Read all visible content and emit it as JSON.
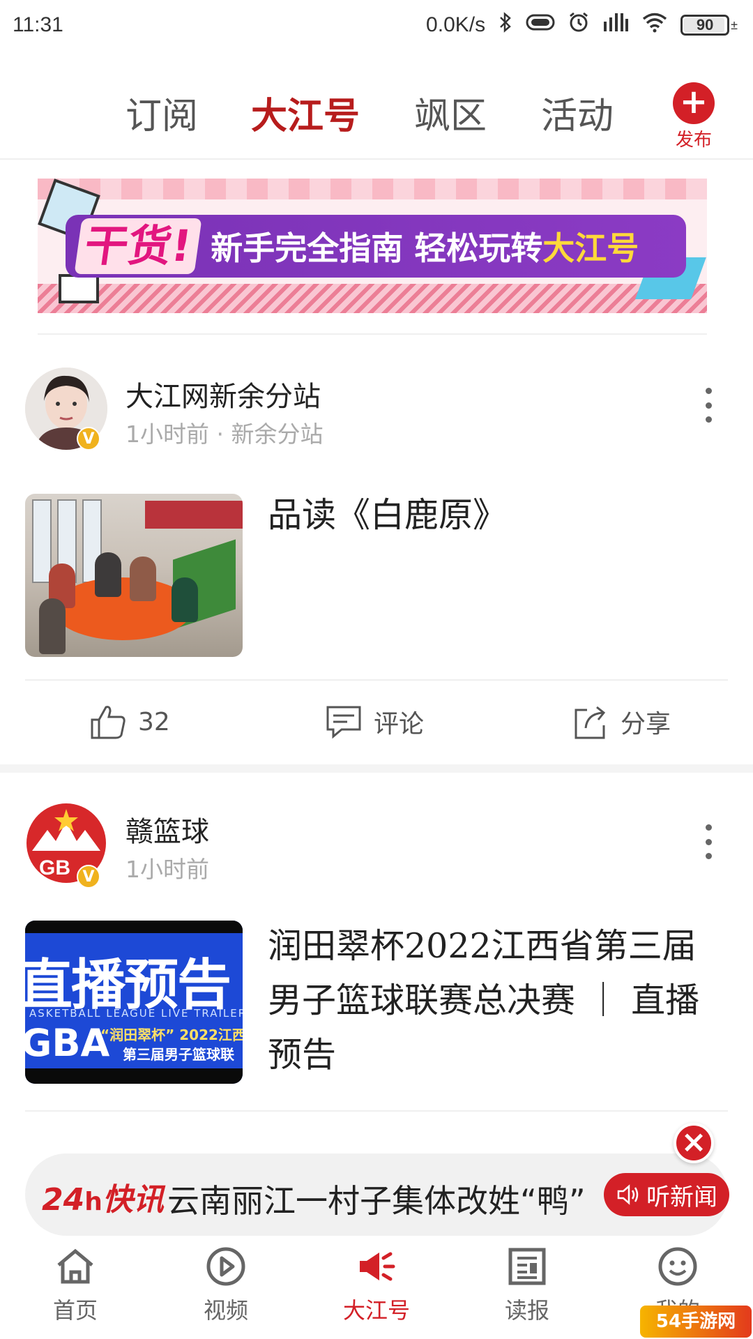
{
  "status_bar": {
    "time": "11:31",
    "net_speed": "0.0K/s",
    "battery": "90"
  },
  "top_tabs": [
    {
      "label": "订阅"
    },
    {
      "label": "大江号"
    },
    {
      "label": "飒区"
    },
    {
      "label": "活动"
    }
  ],
  "publish_label": "发布",
  "banner": {
    "lead": "干货!",
    "text": "新手完全指南 轻松玩转",
    "highlight": "大江号"
  },
  "posts": [
    {
      "author": "大江网新余分站",
      "meta": "1小时前 · 新余分站",
      "title": "品读《白鹿原》",
      "likes": "32",
      "comment_label": "评论",
      "share_label": "分享"
    },
    {
      "author": "赣篮球",
      "meta": "1小时前",
      "title": "润田翠杯2022江西省第三届男子篮球联赛总决赛 ｜ 直播预告",
      "thumb_big": "直播预告",
      "thumb_small": "ASKETBALL LEAGUE LIVE TRAILER",
      "thumb_gba": "GBA",
      "thumb_sub": "“润田翠杯” 2022江西",
      "thumb_sub2": "第三届男子篮球联",
      "avatar_text": "GB"
    }
  ],
  "flash_news": {
    "logo_num": "24",
    "logo_unit": "h",
    "logo_text": "快讯",
    "headline": "云南丽江一村子集体改姓“鸭”",
    "listen_label": "听新闻"
  },
  "bottom_nav": [
    {
      "label": "首页"
    },
    {
      "label": "视频"
    },
    {
      "label": "大江号"
    },
    {
      "label": "读报"
    },
    {
      "label": "我的"
    }
  ],
  "watermark": "54手游网",
  "colors": {
    "accent": "#d32027",
    "active_tab": "#b71c1c"
  }
}
